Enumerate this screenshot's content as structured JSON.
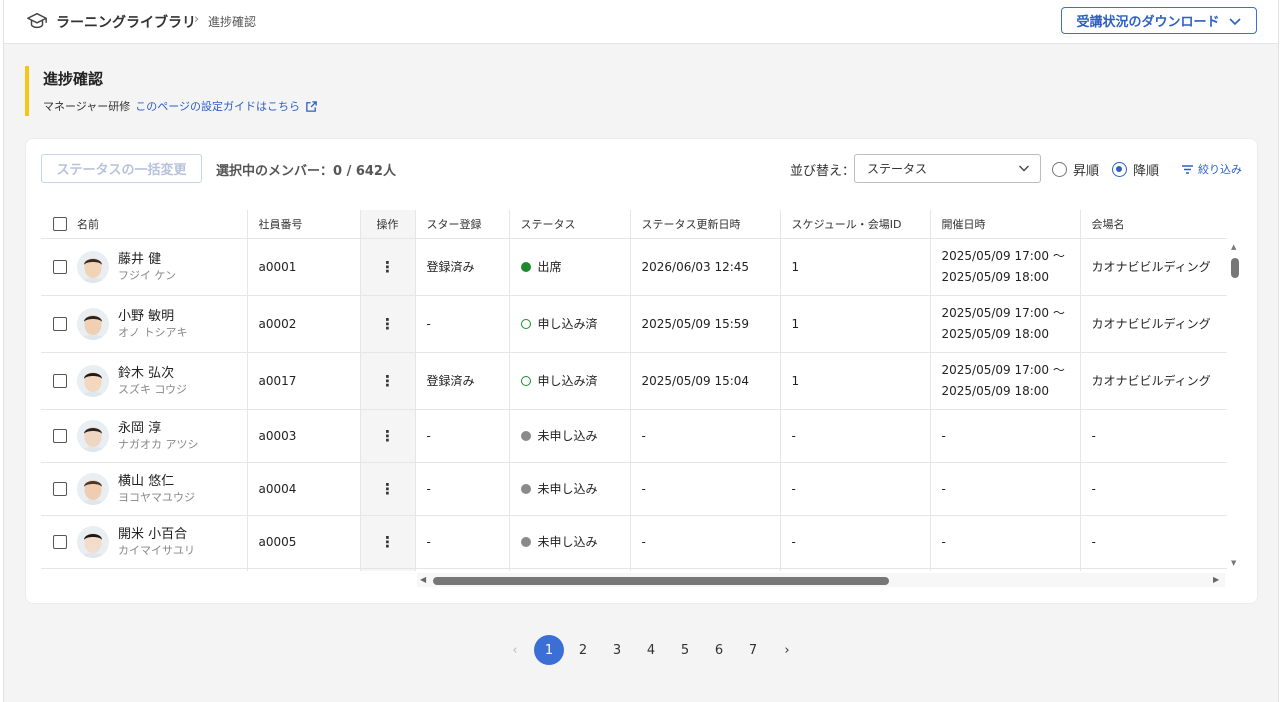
{
  "header": {
    "app_name": "ラーニングライブラリ",
    "separator": "›",
    "current": "進捗確認",
    "download_label": "受講状況のダウンロード"
  },
  "page": {
    "title": "進捗確認",
    "course": "マネージャー研修",
    "guide_link": "このページの設定ガイドはこちら"
  },
  "toolbar": {
    "bulk_change_label": "ステータスの一括変更",
    "selection_text": "選択中のメンバー：0 / 642人",
    "sort_label": "並び替え：",
    "sort_value": "ステータス",
    "order_asc": "昇順",
    "order_desc": "降順",
    "order_selected": "降順",
    "filter_label": "絞り込み"
  },
  "table": {
    "columns": [
      "名前",
      "社員番号",
      "操作",
      "スター登録",
      "ステータス",
      "ステータス更新日時",
      "スケジュール・会場ID",
      "開催日時",
      "会場名"
    ],
    "rows": [
      {
        "name": "藤井 健",
        "kana": "フジイ ケン",
        "emp_no": "a0001",
        "op": "⋮",
        "star": "登録済み",
        "status": "出席",
        "status_kind": "solid-green",
        "updated": "2026/06/03 12:45",
        "schedule_id": "1",
        "date_start": "2025/05/09 17:00 〜",
        "date_end": "2025/05/09 18:00",
        "venue": "カオナビビルディング"
      },
      {
        "name": "小野 敏明",
        "kana": "オノ トシアキ",
        "emp_no": "a0002",
        "op": "⋮",
        "star": "-",
        "status": "申し込み済",
        "status_kind": "ring-green",
        "updated": "2025/05/09 15:59",
        "schedule_id": "1",
        "date_start": "2025/05/09 17:00 〜",
        "date_end": "2025/05/09 18:00",
        "venue": "カオナビビルディング"
      },
      {
        "name": "鈴木 弘次",
        "kana": "スズキ コウジ",
        "emp_no": "a0017",
        "op": "⋮",
        "star": "登録済み",
        "status": "申し込み済",
        "status_kind": "ring-green",
        "updated": "2025/05/09 15:04",
        "schedule_id": "1",
        "date_start": "2025/05/09 17:00 〜",
        "date_end": "2025/05/09 18:00",
        "venue": "カオナビビルディング"
      },
      {
        "name": "永岡 淳",
        "kana": "ナガオカ アツシ",
        "emp_no": "a0003",
        "op": "⋮",
        "star": "-",
        "status": "未申し込み",
        "status_kind": "gray",
        "updated": "-",
        "schedule_id": "-",
        "date_start": "-",
        "date_end": "",
        "venue": "-"
      },
      {
        "name": "横山 悠仁",
        "kana": "ヨコヤマユウジ",
        "emp_no": "a0004",
        "op": "⋮",
        "star": "-",
        "status": "未申し込み",
        "status_kind": "gray",
        "updated": "-",
        "schedule_id": "-",
        "date_start": "-",
        "date_end": "",
        "venue": "-"
      },
      {
        "name": "開米 小百合",
        "kana": "カイマイサユリ",
        "emp_no": "a0005",
        "op": "⋮",
        "star": "-",
        "status": "未申し込み",
        "status_kind": "gray",
        "updated": "-",
        "schedule_id": "-",
        "date_start": "-",
        "date_end": "",
        "venue": "-"
      }
    ]
  },
  "pagination": {
    "pages": [
      "1",
      "2",
      "3",
      "4",
      "5",
      "6",
      "7"
    ],
    "current": "1",
    "prev": "‹",
    "next": "›"
  },
  "colors": {
    "accent": "#3b6fd6",
    "title_bar": "#f5c518",
    "attended": "#1e8a2e",
    "not_applied": "#8a8a8a"
  }
}
